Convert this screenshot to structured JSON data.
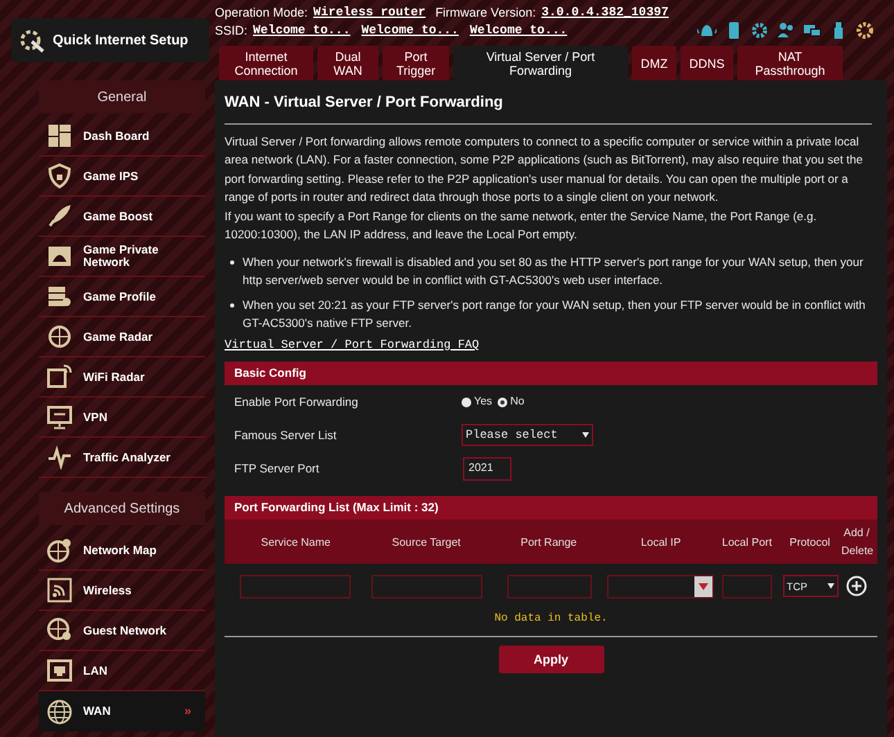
{
  "header": {
    "quick_setup": "Quick Internet Setup",
    "operation_mode_label": "Operation Mode:",
    "operation_mode": "Wireless router",
    "firmware_label": "Firmware Version:",
    "firmware": "3.0.0.4.382_10397",
    "ssid_label": "SSID:",
    "ssids": [
      "Welcome to...",
      "Welcome to...",
      "Welcome to..."
    ]
  },
  "sidebar": {
    "sections": [
      {
        "title": "General",
        "items": [
          {
            "label": "Dash Board",
            "selected": false
          },
          {
            "label": "Game IPS",
            "selected": false
          },
          {
            "label": "Game Boost",
            "selected": false
          },
          {
            "label": "Game Private Network",
            "selected": false
          },
          {
            "label": "Game Profile",
            "selected": false
          },
          {
            "label": "Game Radar",
            "selected": false
          },
          {
            "label": "WiFi Radar",
            "selected": false
          },
          {
            "label": "VPN",
            "selected": false
          },
          {
            "label": "Traffic Analyzer",
            "selected": false
          }
        ]
      },
      {
        "title": "Advanced Settings",
        "items": [
          {
            "label": "Network Map",
            "selected": false
          },
          {
            "label": "Wireless",
            "selected": false
          },
          {
            "label": "Guest Network",
            "selected": false
          },
          {
            "label": "LAN",
            "selected": false
          },
          {
            "label": "WAN",
            "selected": true,
            "arrow": "»"
          }
        ]
      }
    ]
  },
  "tabs": [
    {
      "label": "Internet Connection",
      "selected": false
    },
    {
      "label": "Dual WAN",
      "selected": false
    },
    {
      "label": "Port Trigger",
      "selected": false
    },
    {
      "label": "Virtual Server / Port Forwarding",
      "selected": true
    },
    {
      "label": "DMZ",
      "selected": false
    },
    {
      "label": "DDNS",
      "selected": false
    },
    {
      "label": "NAT Passthrough",
      "selected": false
    }
  ],
  "page": {
    "title": "WAN - Virtual Server / Port Forwarding",
    "description": [
      "Virtual Server / Port forwarding allows remote computers to connect to a specific computer or service within a private local area network (LAN). For a faster connection, some P2P applications (such as BitTorrent), may also require that you set the port forwarding setting. Please refer to the P2P application's user manual for details. You can open the multiple port or a range of ports in router and redirect data through those ports to a single client on your network.",
      "If you want to specify a Port Range for clients on the same network, enter the Service Name, the Port Range (e.g. 10200:10300), the LAN IP address, and leave the Local Port empty."
    ],
    "notes": [
      "When your network's firewall is disabled and you set 80 as the HTTP server's port range for your WAN setup, then your http server/web server would be in conflict with GT-AC5300's web user interface.",
      "When you set 20:21 as your FTP server's port range for your WAN setup, then your FTP server would be in conflict with GT-AC5300's native FTP server."
    ],
    "faq_link": "Virtual Server / Port Forwarding FAQ"
  },
  "basic_config": {
    "title": "Basic Config",
    "enable_label": "Enable Port Forwarding",
    "enable_options": [
      {
        "label": "Yes",
        "selected": false
      },
      {
        "label": "No",
        "selected": true
      }
    ],
    "famous_label": "Famous Server List",
    "famous_value": "Please select",
    "ftp_label": "FTP Server Port",
    "ftp_value": "2021"
  },
  "port_list": {
    "title": "Port Forwarding List (Max Limit : 32)",
    "columns": [
      "Service Name",
      "Source Target",
      "Port Range",
      "Local IP",
      "Local Port",
      "Protocol",
      "Add / Delete"
    ],
    "protocol": "TCP",
    "empty": "No data in table."
  },
  "apply": "Apply"
}
